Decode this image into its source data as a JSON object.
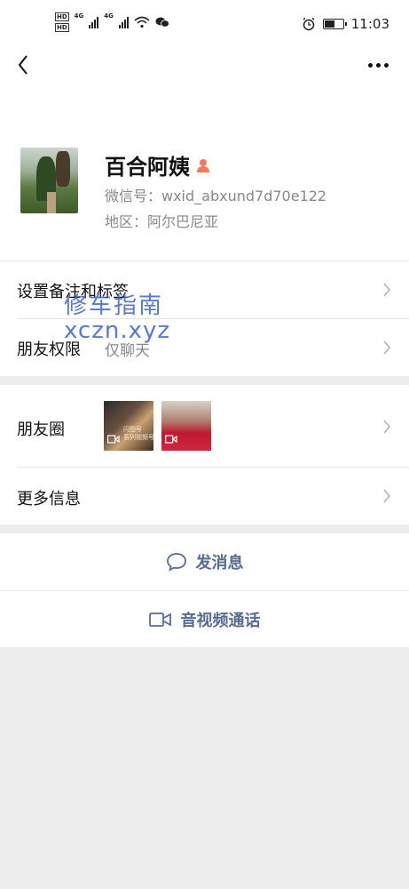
{
  "status_bar": {
    "hd_label": "HD",
    "network_1": "4G",
    "network_2": "4G",
    "time": "11:03",
    "battery_level": 0.6
  },
  "nav": {
    "back_icon": "chevron-left-icon",
    "more_icon": "more-dots-icon"
  },
  "profile": {
    "name": "百合阿姨",
    "gender_icon": "female-user-icon",
    "wechat_id": "微信号：wxid_abxund7d70e122",
    "region": "地区：阿尔巴尼亚"
  },
  "watermark": {
    "line1": "修车指南",
    "line2": "xczn.xyz"
  },
  "rows": {
    "remark_tags": "设置备注和标签",
    "permissions_label": "朋友权限",
    "permissions_value": "仅聊天",
    "moments_label": "朋友圈",
    "more_info": "更多信息"
  },
  "moments_thumbs": [
    {
      "caption": "闪图号\n系列视频号"
    },
    {
      "caption": ""
    }
  ],
  "actions": {
    "send_message": "发消息",
    "video_call": "音视频通话"
  },
  "colors": {
    "accent": "#576b95",
    "background": "#ededed",
    "watermark": "#3a62c8"
  }
}
